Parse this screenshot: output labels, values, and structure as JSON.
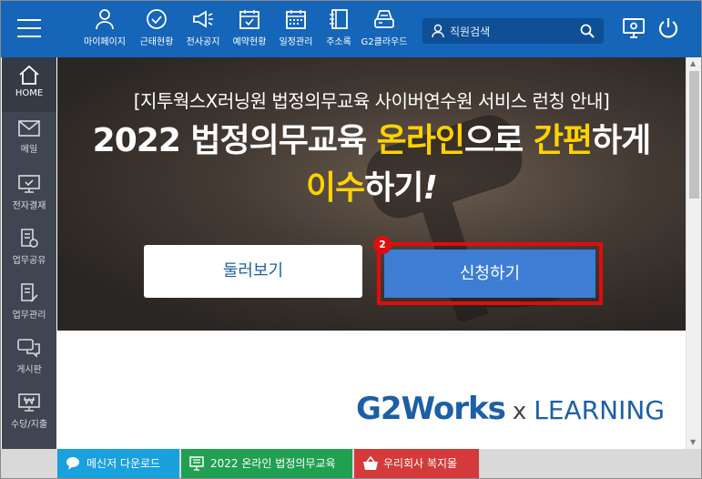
{
  "nav": [
    {
      "label": "마이페이지",
      "icon": "person-icon"
    },
    {
      "label": "근태현황",
      "icon": "check-circle-icon"
    },
    {
      "label": "전사공지",
      "icon": "megaphone-icon"
    },
    {
      "label": "예약현황",
      "icon": "calendar-check-icon"
    },
    {
      "label": "일정관리",
      "icon": "calendar-grid-icon"
    },
    {
      "label": "주소록",
      "icon": "address-book-icon"
    },
    {
      "label": "G2클라우드",
      "icon": "cloud-drive-icon"
    }
  ],
  "search": {
    "placeholder": "직원검색"
  },
  "header_icons": [
    "monitor-settings-icon",
    "power-icon"
  ],
  "sidebar": [
    {
      "label": "HOME",
      "icon": "home-icon"
    },
    {
      "label": "메일",
      "icon": "mail-icon"
    },
    {
      "label": "전자결재",
      "icon": "approval-monitor-icon"
    },
    {
      "label": "업무공유",
      "icon": "document-gear-icon"
    },
    {
      "label": "업무관리",
      "icon": "document-edit-icon"
    },
    {
      "label": "게시판",
      "icon": "chat-board-icon"
    },
    {
      "label": "수당/지출",
      "icon": "won-monitor-icon"
    }
  ],
  "banner": {
    "subtitle": "[지투웍스X러닝원 법정의무교육 사이버연수원 서비스 런칭 안내]",
    "line1_a": "2022 법정의무교육 ",
    "line1_b": "온라인",
    "line1_c": "으로 ",
    "line1_d": "간편",
    "line1_e": "하게",
    "line2_a": "이수",
    "line2_b": "하기",
    "line2_c": "!",
    "browse_label": "둘러보기",
    "apply_label": "신청하기",
    "badge": "2"
  },
  "logo": {
    "part1": "G2W",
    "part2": "orks",
    "x": "x",
    "part3": "LEARNING"
  },
  "bottom": [
    {
      "label": "메신저 다운로드",
      "color": "#1aa0dc",
      "icon": "chat-bubble-icon"
    },
    {
      "label": "2022 온라인 법정의무교육",
      "color": "#22a052",
      "icon": "monitor-book-icon"
    },
    {
      "label": "우리회사 복지몰",
      "color": "#d43a3a",
      "icon": "basket-icon"
    }
  ],
  "colors": {
    "header": "#1565b8",
    "sidebar": "#3f4651",
    "highlight": "#ffd200",
    "apply": "#3d7ed4",
    "callout": "#e10c0c"
  }
}
